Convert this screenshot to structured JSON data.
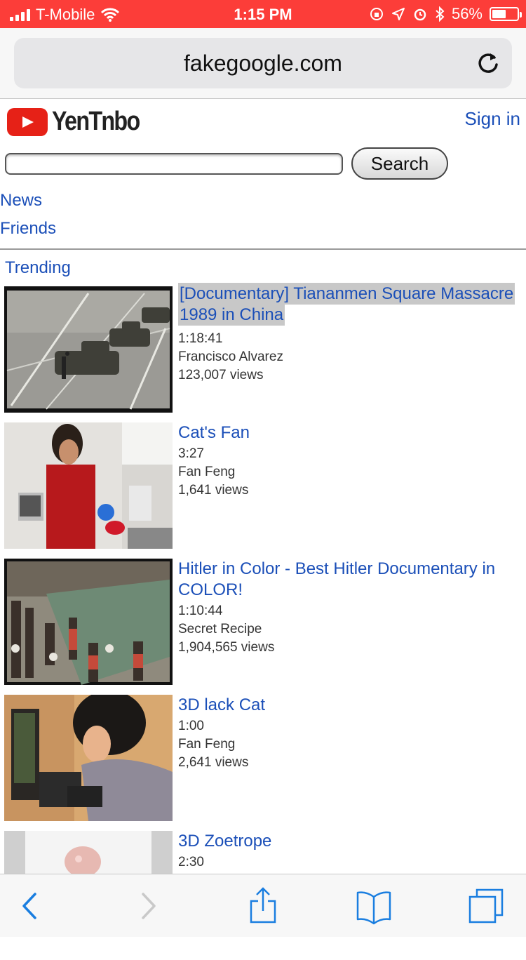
{
  "status_bar": {
    "carrier": "T-Mobile",
    "time": "1:15 PM",
    "battery": "56%",
    "battery_level": 0.56
  },
  "browser": {
    "url": "fakegoogle.com"
  },
  "site": {
    "logo_text": "YenTnbo",
    "sign_in": "Sign in",
    "search_button": "Search",
    "search_value": "",
    "nav": [
      "News",
      "Friends"
    ],
    "section_title": "Trending"
  },
  "videos": [
    {
      "title": "[Documentary] Tiananmen Square Massacre 1989 in China",
      "duration": "1:18:41",
      "author": "Francisco Alvarez",
      "views": "123,007 views",
      "highlighted": true
    },
    {
      "title": "Cat's Fan",
      "duration": "3:27",
      "author": "Fan Feng",
      "views": "1,641 views",
      "highlighted": false
    },
    {
      "title": "Hitler in Color - Best Hitler Documentary in COLOR!",
      "duration": "1:10:44",
      "author": "Secret Recipe",
      "views": "1,904,565 views",
      "highlighted": false
    },
    {
      "title": "3D lack Cat",
      "duration": "1:00",
      "author": "Fan Feng",
      "views": "2,641 views",
      "highlighted": false
    },
    {
      "title": "3D Zoetrope",
      "duration": "2:30",
      "author": "",
      "views": "",
      "highlighted": false
    }
  ],
  "colors": {
    "status_bar": "#fc3d39",
    "link": "#1b4fb8",
    "logo_red": "#e62117",
    "ios_blue": "#1a7ee0"
  },
  "icons": {
    "toolbar": [
      "back-icon",
      "forward-icon",
      "share-icon",
      "bookmarks-icon",
      "tabs-icon"
    ]
  }
}
